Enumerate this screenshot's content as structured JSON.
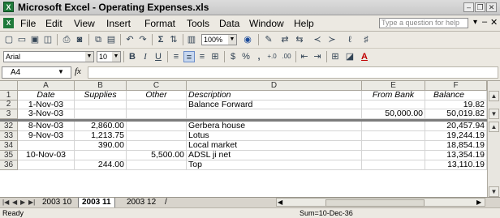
{
  "window": {
    "title": "Microsoft Excel - Operating Expenses.xls"
  },
  "menu": [
    "File",
    "Edit",
    "View",
    "Insert",
    "Format",
    "Tools",
    "Data",
    "Window",
    "Help"
  ],
  "help_placeholder": "Type a question for help",
  "toolbar": {
    "zoom": "100%",
    "font": "Arial",
    "size": "10",
    "bold": "B",
    "italic": "I",
    "underline": "U",
    "currency": "$",
    "percent": "%",
    "comma": ",",
    "sigma": "Σ"
  },
  "formula": {
    "namebox": "A4",
    "fx": "fx"
  },
  "columns": [
    "A",
    "B",
    "C",
    "D",
    "E",
    "F"
  ],
  "header_row": {
    "num": "1",
    "cells": [
      "Date",
      "Supplies",
      "Other",
      "Description",
      "From Bank",
      "Balance"
    ]
  },
  "rows_top": [
    {
      "num": "2",
      "cells": [
        "1-Nov-03",
        "",
        "",
        "Balance Forward",
        "",
        "19.82"
      ]
    },
    {
      "num": "3",
      "cells": [
        "3-Nov-03",
        "",
        "",
        "",
        "50,000.00",
        "50,019.82"
      ]
    }
  ],
  "rows_bottom": [
    {
      "num": "32",
      "cells": [
        "8-Nov-03",
        "2,860.00",
        "",
        "Gerbera house",
        "",
        "20,457.94"
      ]
    },
    {
      "num": "33",
      "cells": [
        "9-Nov-03",
        "1,213.75",
        "",
        "Lotus",
        "",
        "19,244.19"
      ]
    },
    {
      "num": "34",
      "cells": [
        "",
        "390.00",
        "",
        "Local market",
        "",
        "18,854.19"
      ]
    },
    {
      "num": "35",
      "cells": [
        "10-Nov-03",
        "",
        "5,500.00",
        "ADSL ji net",
        "",
        "13,354.19"
      ]
    },
    {
      "num": "36",
      "cells": [
        "",
        "244.00",
        "",
        "Top",
        "",
        "13,110.19"
      ]
    }
  ],
  "sheets": [
    "2003 10",
    "2003 11",
    "2003 12"
  ],
  "active_sheet": "2003 11",
  "status": {
    "left": "Ready",
    "sum": "Sum=10-Dec-36"
  }
}
